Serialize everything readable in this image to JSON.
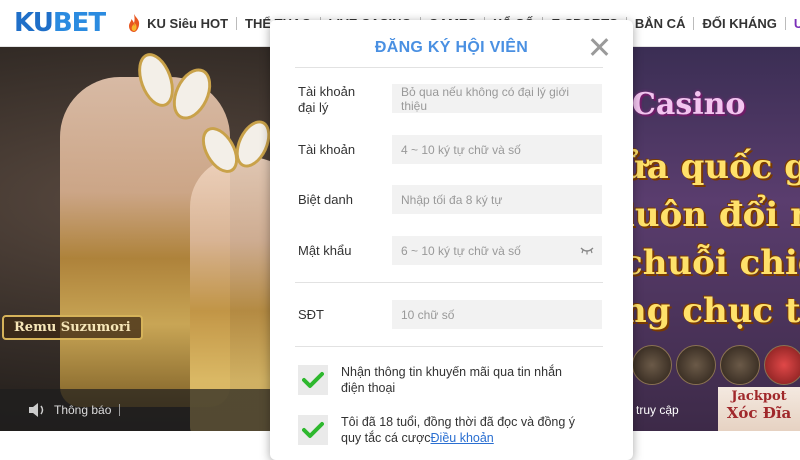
{
  "header": {
    "logo_prefix": "KU",
    "logo_suffix": "BET",
    "nav": [
      {
        "label": "KU Siêu HOT",
        "icon": "flame-icon"
      },
      {
        "label": "THỂ THAO"
      },
      {
        "label": "LIVE CASINO"
      },
      {
        "label": "GAMES"
      },
      {
        "label": "XỔ SỐ"
      },
      {
        "label": "E-SPORTS"
      },
      {
        "label": "BẮN CÁ"
      },
      {
        "label": "ĐỐI KHÁNG"
      },
      {
        "label": "ƯU ĐÃI"
      }
    ]
  },
  "banner": {
    "name_tag": "Remu Suzumori",
    "notice_label": "Thông báo",
    "casino_word": "Casino",
    "promo_lines": [
      "ửa quốc g",
      "luôn đổi m",
      "chuỗi chiế",
      "ng chục tr"
    ],
    "live_label": "truy cập",
    "jackpot_line1": "Jackpot",
    "jackpot_line2": "Xóc Đĩa"
  },
  "modal": {
    "title": "ĐĂNG KÝ HỘI VIÊN",
    "fields": {
      "agent_label": "Tài khoản đại lý",
      "agent_placeholder": "Bỏ qua nếu không có đại lý giới thiệu",
      "account_label": "Tài khoản",
      "account_placeholder": "4 ~ 10 ký tự chữ và số",
      "nickname_label": "Biệt danh",
      "nickname_placeholder": "Nhập tối đa 8 ký tự",
      "password_label": "Mật khẩu",
      "password_placeholder": "6 ~ 10 ký tự chữ và số",
      "phone_label": "SĐT",
      "phone_placeholder": "10 chữ số"
    },
    "checks": {
      "promo_text": "Nhận thông tin khuyến mãi qua tin nhắn điện thoại",
      "age_text": "Tôi đã 18 tuổi, đồng thời đã đọc và đồng ý quy tắc cá cược",
      "terms_link": "Điều khoản"
    }
  },
  "colors": {
    "title_blue": "#4a90e2",
    "check_green": "#2eb82e",
    "active_nav": "#7a2fb8"
  }
}
